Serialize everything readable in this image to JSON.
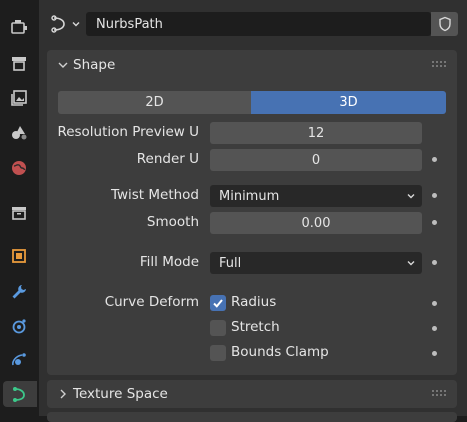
{
  "sidebar": {
    "tabs": [
      {
        "name": "tool-tab",
        "icon": "tool-icon"
      },
      {
        "name": "render-tab",
        "icon": "printer-icon"
      },
      {
        "name": "output-tab",
        "icon": "image-stack-icon"
      },
      {
        "name": "view-layer-tab",
        "icon": "shapes-icon"
      },
      {
        "name": "world-tab",
        "icon": "globe-icon"
      },
      {
        "name": "collection-tab",
        "icon": "box-icon"
      },
      {
        "name": "object-tab",
        "icon": "object-square-icon"
      },
      {
        "name": "modifier-tab",
        "icon": "wrench-icon"
      },
      {
        "name": "particles-tab",
        "icon": "particle-icon"
      },
      {
        "name": "physics-tab",
        "icon": "orbit-icon"
      },
      {
        "name": "curve-data-tab",
        "icon": "curve-icon",
        "active": true
      }
    ]
  },
  "header": {
    "datablock_name": "NurbsPath"
  },
  "shape_panel": {
    "title": "Shape",
    "dimension_options": [
      "2D",
      "3D"
    ],
    "selected_dimension": "3D",
    "resolution_preview_u": {
      "label": "Resolution Preview U",
      "value": "12"
    },
    "render_u": {
      "label": "Render U",
      "value": "0"
    },
    "twist_method": {
      "label": "Twist Method",
      "value": "Minimum"
    },
    "smooth": {
      "label": "Smooth",
      "value": "0.00"
    },
    "fill_mode": {
      "label": "Fill Mode",
      "value": "Full"
    },
    "curve_deform": {
      "label": "Curve Deform",
      "options": [
        {
          "label": "Radius",
          "checked": true
        },
        {
          "label": "Stretch",
          "checked": false
        },
        {
          "label": "Bounds Clamp",
          "checked": false
        }
      ]
    }
  },
  "texture_space_panel": {
    "title": "Texture Space"
  },
  "colors": {
    "accent": "#4772b3",
    "panel": "#3d3d3d",
    "field": "#545454",
    "background": "#303030"
  }
}
